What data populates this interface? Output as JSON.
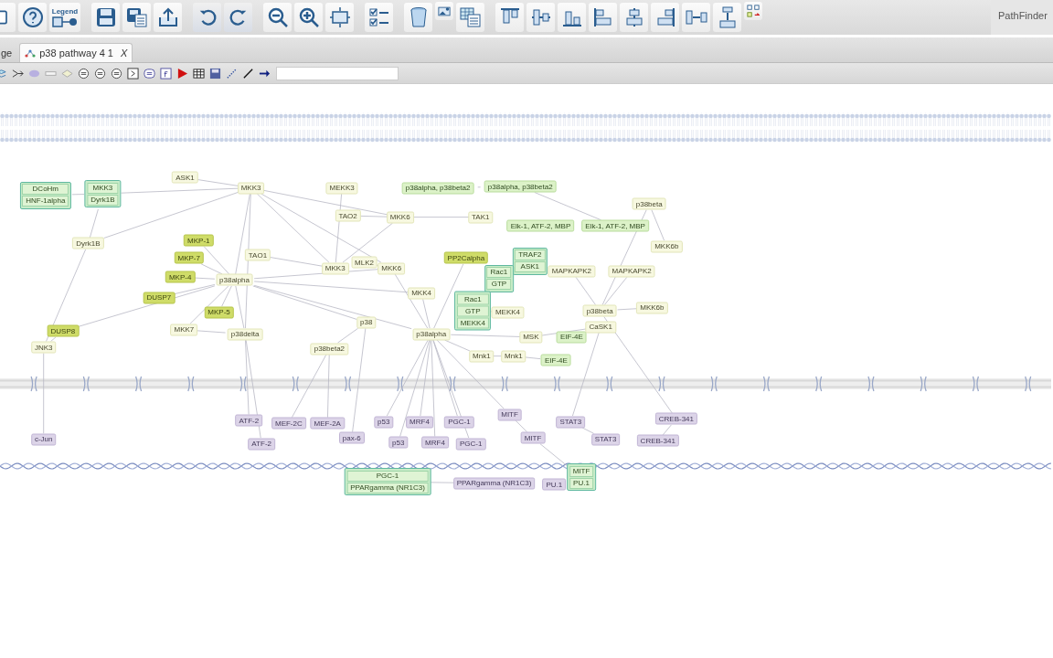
{
  "toolbar": {
    "legend_label": "Legend",
    "app_name": "PathFinder"
  },
  "tabs": [
    {
      "label": "ge",
      "selected": false
    },
    {
      "label": "p38 pathway 4 1",
      "selected": true,
      "close": "X"
    }
  ],
  "diagram": {
    "nodes": [
      {
        "kind": "complex",
        "members": [
          "DCoHm",
          "HNF-1alpha"
        ]
      },
      {
        "kind": "complex",
        "members": [
          "MKK3",
          "Dyrk1B"
        ]
      },
      {
        "kind": "protein",
        "label": "ASK1"
      },
      {
        "kind": "protein",
        "label": "MKK3"
      },
      {
        "kind": "protein",
        "label": "MEKK3"
      },
      {
        "kind": "substrate",
        "label": "p38alpha, p38beta2"
      },
      {
        "kind": "substrate",
        "label": "p38alpha, p38beta2"
      },
      {
        "kind": "protein",
        "label": "TAO2"
      },
      {
        "kind": "protein",
        "label": "MKK6"
      },
      {
        "kind": "protein",
        "label": "TAK1"
      },
      {
        "kind": "protein",
        "label": "p38beta"
      },
      {
        "kind": "substrate",
        "label": "Elk-1, ATF-2, MBP"
      },
      {
        "kind": "substrate",
        "label": "Elk-1, ATF-2, MBP"
      },
      {
        "kind": "protein",
        "label": "Dyrk1B"
      },
      {
        "kind": "inhibitor",
        "label": "MKP-1"
      },
      {
        "kind": "protein",
        "label": "MKK6b"
      },
      {
        "kind": "inhibitor",
        "label": "MKP-7"
      },
      {
        "kind": "protein",
        "label": "TAO1"
      },
      {
        "kind": "protein",
        "label": "MKK3"
      },
      {
        "kind": "protein",
        "label": "MLK2"
      },
      {
        "kind": "protein",
        "label": "MKK6"
      },
      {
        "kind": "inhibitor",
        "label": "PP2Calpha"
      },
      {
        "kind": "complex",
        "members": [
          "TRAF2",
          "ASK1"
        ]
      },
      {
        "kind": "protein",
        "label": "MAPKAPK2"
      },
      {
        "kind": "protein",
        "label": "MAPKAPK2"
      },
      {
        "kind": "inhibitor",
        "label": "MKP-4"
      },
      {
        "kind": "protein",
        "label": "p38alpha"
      },
      {
        "kind": "complex",
        "members": [
          "Rac1",
          "GTP"
        ]
      },
      {
        "kind": "inhibitor",
        "label": "DUSP7"
      },
      {
        "kind": "protein",
        "label": "MKK4"
      },
      {
        "kind": "inhibitor",
        "label": "MKP-5"
      },
      {
        "kind": "complex",
        "members": [
          "Rac1",
          "GTP",
          "MEKK4"
        ]
      },
      {
        "kind": "protein",
        "label": "MEKK4"
      },
      {
        "kind": "protein",
        "label": "p38beta"
      },
      {
        "kind": "protein",
        "label": "MKK6b"
      },
      {
        "kind": "inhibitor",
        "label": "DUSP8"
      },
      {
        "kind": "protein",
        "label": "MKK7"
      },
      {
        "kind": "protein",
        "label": "p38delta"
      },
      {
        "kind": "protein",
        "label": "p38"
      },
      {
        "kind": "protein",
        "label": "p38alpha"
      },
      {
        "kind": "protein",
        "label": "MSK"
      },
      {
        "kind": "substrate",
        "label": "EIF-4E"
      },
      {
        "kind": "protein",
        "label": "CaSK1"
      },
      {
        "kind": "protein",
        "label": "JNK3"
      },
      {
        "kind": "protein",
        "label": "p38beta2"
      },
      {
        "kind": "protein",
        "label": "Mnk1"
      },
      {
        "kind": "protein",
        "label": "Mnk1"
      },
      {
        "kind": "substrate",
        "label": "EIF-4E"
      },
      {
        "kind": "nuclear",
        "label": "ATF-2"
      },
      {
        "kind": "nuclear",
        "label": "MEF-2C"
      },
      {
        "kind": "nuclear",
        "label": "MEF-2A"
      },
      {
        "kind": "nuclear",
        "label": "p53"
      },
      {
        "kind": "nuclear",
        "label": "MRF4"
      },
      {
        "kind": "nuclear",
        "label": "PGC-1"
      },
      {
        "kind": "nuclear",
        "label": "MITF"
      },
      {
        "kind": "nuclear",
        "label": "STAT3"
      },
      {
        "kind": "nuclear",
        "label": "CREB-341"
      },
      {
        "kind": "nuclear",
        "label": "c-Jun"
      },
      {
        "kind": "nuclear",
        "label": "ATF-2"
      },
      {
        "kind": "nuclear",
        "label": "pax-6"
      },
      {
        "kind": "nuclear",
        "label": "p53"
      },
      {
        "kind": "nuclear",
        "label": "MRF4"
      },
      {
        "kind": "nuclear",
        "label": "PGC-1"
      },
      {
        "kind": "nuclear",
        "label": "MITF"
      },
      {
        "kind": "nuclear",
        "label": "STAT3"
      },
      {
        "kind": "nuclear",
        "label": "CREB-341"
      },
      {
        "kind": "complex",
        "members": [
          "PGC-1",
          "PPARgamma (NR1C3)"
        ]
      },
      {
        "kind": "nuclear",
        "label": "PPARgamma (NR1C3)"
      },
      {
        "kind": "nuclear",
        "label": "PU.1"
      },
      {
        "kind": "complex",
        "members": [
          "MITF",
          "PU.1"
        ]
      }
    ]
  }
}
